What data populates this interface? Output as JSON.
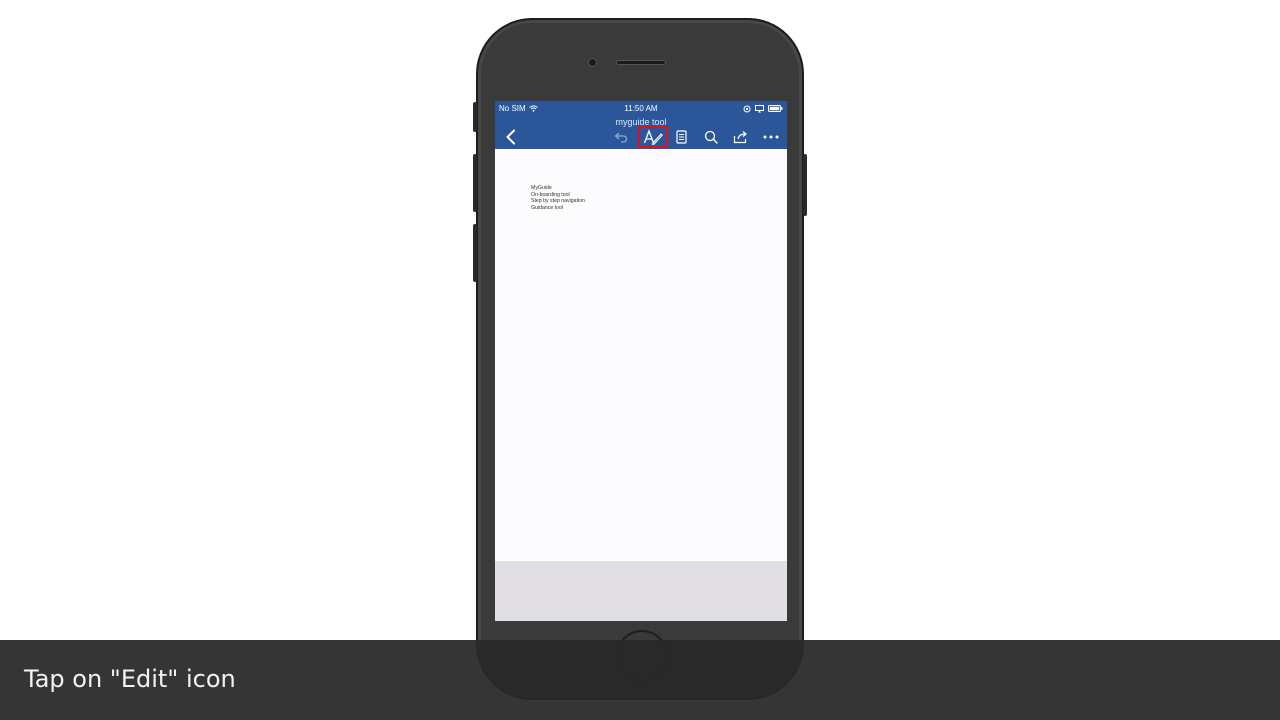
{
  "status_bar": {
    "carrier": "No SIM",
    "time": "11:50 AM",
    "icons": [
      "wifi-icon",
      "orientation-lock-icon",
      "screen-mirroring-icon",
      "battery-icon"
    ]
  },
  "toolbar": {
    "doc_title": "myguide tool",
    "buttons": [
      "back-icon",
      "undo-icon",
      "edit-icon",
      "reading-view-icon",
      "search-icon",
      "share-icon",
      "more-icon"
    ],
    "highlight_color": "#e0101a",
    "bar_color": "#2b579a"
  },
  "document": {
    "lines": [
      "MyGuide",
      "On-boarding tool",
      "Step by step navigation",
      "Guidance tool"
    ]
  },
  "caption": {
    "text": "Tap on \"Edit\" icon"
  }
}
